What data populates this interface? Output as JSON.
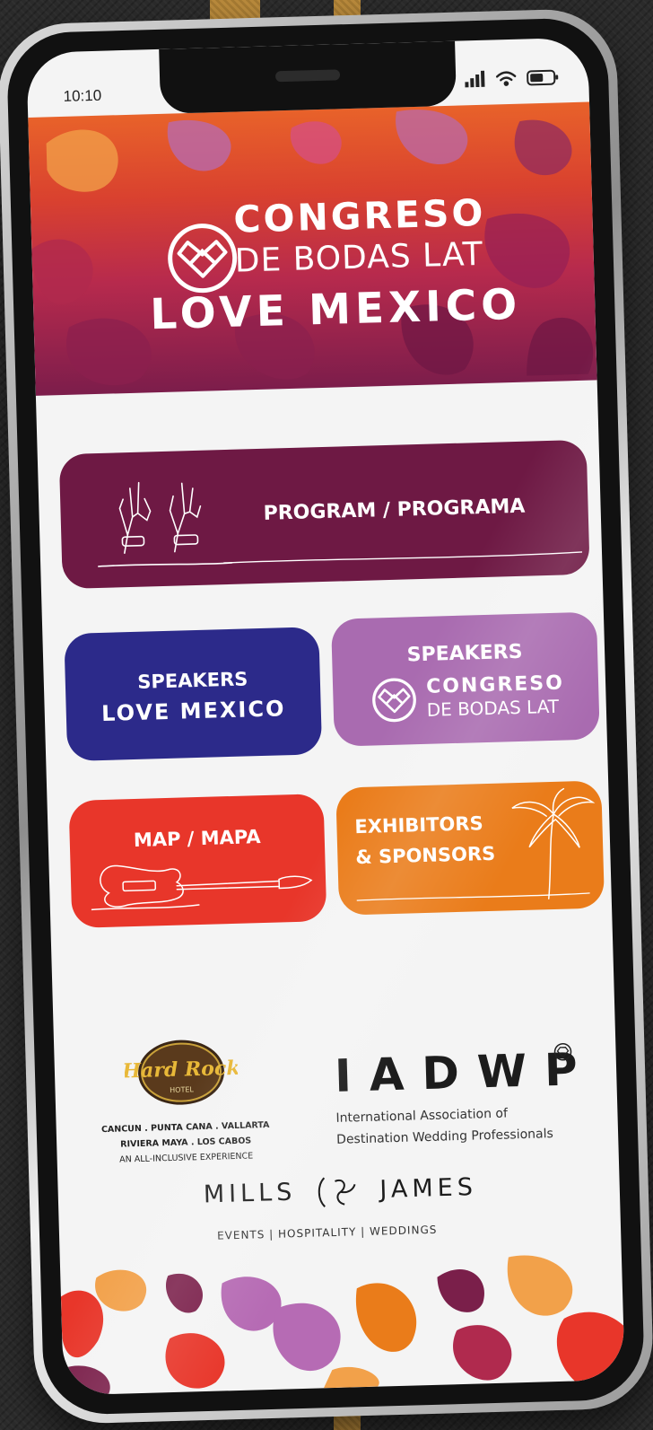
{
  "status_bar": {
    "time": "10:10"
  },
  "hero": {
    "title": "CONGRESO",
    "subtitle": "DE BODAS LAT",
    "edition": "LOVE MEXICO"
  },
  "menu": {
    "program": "PROGRAM / PROGRAMA",
    "speakers_love_mexico": {
      "line1": "SPEAKERS",
      "line2": "LOVE MEXICO"
    },
    "speakers_congreso": {
      "line1": "SPEAKERS",
      "line2": "CONGRESO",
      "line3": "DE BODAS LAT"
    },
    "map": "MAP / MAPA",
    "exhibitors": {
      "line1": "EXHIBITORS",
      "line2": "& SPONSORS"
    }
  },
  "sponsors": {
    "hardrock": {
      "logo_text": "Hard Rock",
      "logo_sub": "HOTEL",
      "line1": "CANCUN . PUNTA CANA . VALLARTA",
      "line2": "RIVIERA MAYA . LOS CABOS",
      "line3": "AN ALL-INCLUSIVE EXPERIENCE"
    },
    "iadwp": {
      "title": "IADWP",
      "line1": "International Association of",
      "line2": "Destination Wedding Professionals"
    },
    "mills_james": {
      "name_left": "MILLS",
      "name_right": "JAMES",
      "tagline": "EVENTS  |  HOSPITALITY  |  WEDDINGS"
    }
  },
  "colors": {
    "program": "#6e1944",
    "speakers_love_mexico": "#2c2a8a",
    "speakers_congreso": "#a96bb0",
    "map": "#e8362a",
    "exhibitors": "#ea7c1a"
  }
}
